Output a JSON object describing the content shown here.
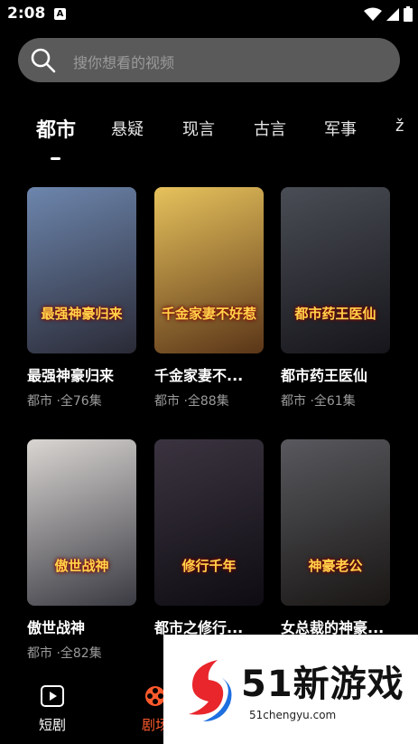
{
  "status": {
    "time": "2:08",
    "badge": "A"
  },
  "search": {
    "placeholder": "搜你想看的视频"
  },
  "tabs": [
    "都市",
    "悬疑",
    "现言",
    "古言",
    "军事",
    "ž"
  ],
  "cards": [
    {
      "title": "最强神豪归来",
      "meta": "都市 ·全76集",
      "poster_text": "最强神豪归来",
      "colors": [
        "#6d86ad",
        "#2a2a36"
      ]
    },
    {
      "title": "千金家妻不...",
      "meta": "都市 ·全88集",
      "poster_text": "千金家妻不好惹",
      "colors": [
        "#e7c25c",
        "#5a3518"
      ]
    },
    {
      "title": "都市药王医仙",
      "meta": "都市 ·全61集",
      "poster_text": "都市药王医仙",
      "colors": [
        "#4a4d55",
        "#15151a"
      ]
    },
    {
      "title": "傲世战神",
      "meta": "都市 ·全82集",
      "poster_text": "傲世战神",
      "colors": [
        "#d9d6d2",
        "#3a3a42"
      ]
    },
    {
      "title": "都市之修行...",
      "meta": "",
      "poster_text": "修行千年",
      "colors": [
        "#3b3440",
        "#0e0c12"
      ]
    },
    {
      "title": "女总裁的神豪...",
      "meta": "",
      "poster_text": "神豪老公",
      "colors": [
        "#58595e",
        "#191614"
      ]
    }
  ],
  "nav": {
    "items": [
      {
        "label": "短剧"
      },
      {
        "label": "剧场"
      }
    ]
  },
  "watermark": {
    "text": "51新游戏",
    "url": "51chengyu.com"
  }
}
